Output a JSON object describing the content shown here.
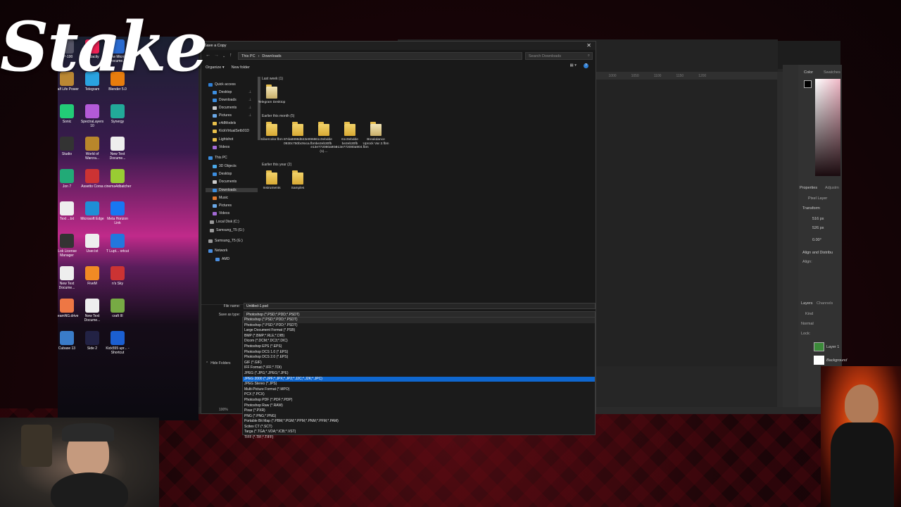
{
  "overlay": {
    "logo_text": "Stake"
  },
  "desktop_icons": [
    {
      "label": "SP-100",
      "color": "#556"
    },
    {
      "label": "Audacity",
      "color": "#e25"
    },
    {
      "label": "New Micros Docume...",
      "color": "#2a6bd0"
    },
    {
      "label": "Half Life Power",
      "color": "#b83"
    },
    {
      "label": "Telegram",
      "color": "#2aa3e0"
    },
    {
      "label": "Blender 5.0",
      "color": "#e87d0d"
    },
    {
      "label": "Sonic",
      "color": "#2c7"
    },
    {
      "label": "SpectraLayers 10",
      "color": "#b35ad8"
    },
    {
      "label": "Synergy",
      "color": "#2a9"
    },
    {
      "label": "Studio",
      "color": "#333"
    },
    {
      "label": "World of Warcra...",
      "color": "#b8862b"
    },
    {
      "label": "New Text Docume...",
      "color": "#eee"
    },
    {
      "label": "Jon 7",
      "color": "#2a7"
    },
    {
      "label": "Assetto Corsa",
      "color": "#c33"
    },
    {
      "label": "cinema4dbatcher",
      "color": "#9c3"
    },
    {
      "label": "Text ...txt",
      "color": "#eee"
    },
    {
      "label": "Microsoft Edge",
      "color": "#1f8fd6"
    },
    {
      "label": "Meta Horizon Link",
      "color": "#1877f2"
    },
    {
      "label": "iLok License Manager",
      "color": "#333"
    },
    {
      "label": "User.txt",
      "color": "#eee"
    },
    {
      "label": "T Lupt... ortcut",
      "color": "#2277dd"
    },
    {
      "label": "New Text Docume...",
      "color": "#eee"
    },
    {
      "label": "FiveM",
      "color": "#f08a24"
    },
    {
      "label": "n's Sky",
      "color": "#c33"
    },
    {
      "label": "BeamNG.drive",
      "color": "#e74"
    },
    {
      "label": "New Text Docume...",
      "color": "#eee"
    },
    {
      "label": "craft III",
      "color": "#7a4"
    },
    {
      "label": "Cubase 13",
      "color": "#3a7cc8"
    },
    {
      "label": "Side 2",
      "color": "#224"
    },
    {
      "label": "Kick555 upr... - Shortcut",
      "color": "#1b5fd1"
    }
  ],
  "photoshop": {
    "ruler_ticks": [
      "500",
      "550",
      "600",
      "650",
      "700",
      "750",
      "800",
      "850",
      "900",
      "950",
      "1000",
      "1050",
      "1100",
      "1150",
      "1200"
    ],
    "panel_tabs": [
      "Color",
      "Swatches",
      "Properties",
      "Adjustm",
      "Layers",
      "Channels"
    ],
    "properties": {
      "kind": "Pixel Layer",
      "transform": "Transform",
      "w": "516 px",
      "h": "526 px",
      "angle": "0.00°",
      "align": "Align and Distribu",
      "align_label": "Align:"
    },
    "layers": {
      "kind": "Kind",
      "mode": "Normal",
      "lock": "Lock:",
      "layer1": "Layer 1",
      "background": "Background"
    }
  },
  "dialog": {
    "title": "Save a Copy",
    "breadcrumb": [
      "This PC",
      "Downloads"
    ],
    "search_placeholder": "Search Downloads",
    "organize": "Organize",
    "new_folder": "New folder",
    "nav": [
      {
        "label": "Quick access",
        "color": "#2f7fd5",
        "pinned": false
      },
      {
        "label": "Desktop",
        "color": "#3c8ee0",
        "pinned": true
      },
      {
        "label": "Downloads",
        "color": "#3c8ee0",
        "pinned": true
      },
      {
        "label": "Documents",
        "color": "#ccc",
        "pinned": true
      },
      {
        "label": "Pictures",
        "color": "#6aa9e8",
        "pinned": true
      },
      {
        "label": "c4dModels",
        "color": "#e9c04a",
        "pinned": false
      },
      {
        "label": "KickVirtualSetb01D",
        "color": "#e9c04a",
        "pinned": false
      },
      {
        "label": "Lightshot",
        "color": "#e9c04a",
        "pinned": false
      },
      {
        "label": "Videos",
        "color": "#a36ad6",
        "pinned": false
      },
      {
        "label": "This PC",
        "color": "#3c8ee0",
        "pinned": false
      },
      {
        "label": "3D Objects",
        "color": "#4aa8e8",
        "pinned": false
      },
      {
        "label": "Desktop",
        "color": "#3c8ee0",
        "pinned": false
      },
      {
        "label": "Documents",
        "color": "#ccc",
        "pinned": false
      },
      {
        "label": "Downloads",
        "color": "#3c8ee0",
        "pinned": false
      },
      {
        "label": "Music",
        "color": "#e07a2f",
        "pinned": false
      },
      {
        "label": "Pictures",
        "color": "#6aa9e8",
        "pinned": false
      },
      {
        "label": "Videos",
        "color": "#a36ad6",
        "pinned": false
      },
      {
        "label": "Local Disk (C:)",
        "color": "#999",
        "pinned": false
      },
      {
        "label": "Samsung_T5 (G:)",
        "color": "#999",
        "pinned": false
      },
      {
        "label": "Samsung_T5 (G:)",
        "color": "#999",
        "pinned": false
      },
      {
        "label": "Network",
        "color": "#4a8ee0",
        "pinned": false
      },
      {
        "label": "AMD",
        "color": "#4a8ee0",
        "pinned": false
      }
    ],
    "groups": [
      {
        "header": "Last week (1)",
        "files": [
          {
            "name": "Telegram Desktop",
            "type": "folder-doc"
          }
        ]
      },
      {
        "header": "Earlier this month (5)",
        "files": [
          {
            "name": "Silvercolor.fbm",
            "type": "folder"
          },
          {
            "name": "87da8898d843e9968 0930c750bc9oca.fbm",
            "type": "folder"
          },
          {
            "name": "61c0ebdde be2eb30fb e13e772080a904 (1)....",
            "type": "folder"
          },
          {
            "name": "61c0ebdde be2eb30fb e13e772080a904.fbm",
            "type": "folder"
          },
          {
            "name": "Breakdance Uprock Var 2.fbm",
            "type": "folder-doc"
          }
        ]
      },
      {
        "header": "Earlier this year (2)",
        "files": [
          {
            "name": "Instruments",
            "type": "folder"
          },
          {
            "name": "Samples",
            "type": "folder"
          }
        ]
      }
    ],
    "file_name_label": "File name:",
    "file_name_value": "Untitled-1.psd",
    "save_type_label": "Save as type:",
    "save_type_value": "Photoshop (*.PSD;*.PDD;*.PSDT)",
    "hide_folders": "Hide Folders",
    "zoom": "100%",
    "type_options": [
      "Photoshop (*.PSD;*.PDD;*.PSDT)",
      "Large Document Format (*.PSB)",
      "BMP (*.BMP;*.RLE;*.DIB)",
      "Dicom (*.DCM;*.DC3;*.DIC)",
      "Photoshop EPS (*.EPS)",
      "Photoshop DCS 1.0 (*.EPS)",
      "Photoshop DCS 2.0 (*.EPS)",
      "GIF (*.GIF)",
      "IFF Format (*.IFF;*.TDI)",
      "JPEG (*.JPG;*.JPEG;*.JPE)",
      "JPEG 2000 (*.JPF;*.JPX;*.JP2;*.J2C;*.J2K;*.JPC)",
      "JPEG Stereo (*.JPS)",
      "Multi-Picture Format (*.MPO)",
      "PCX (*.PCX)",
      "Photoshop PDF (*.PDF;*.PDP)",
      "Photoshop Raw (*.RAW)",
      "Pixar (*.PXR)",
      "PNG (*.PNG;*.PNG)",
      "Portable Bit Map (*.PBM;*.PGM;*.PPM;*.PNM;*.PFM;*.PAM)",
      "Scitex CT (*.SCT)",
      "Targa (*.TGA;*.VDA;*.ICB;*.VST)",
      "TIFF (*.TIF;*.TIFF)"
    ],
    "selected_option_index": 10
  }
}
